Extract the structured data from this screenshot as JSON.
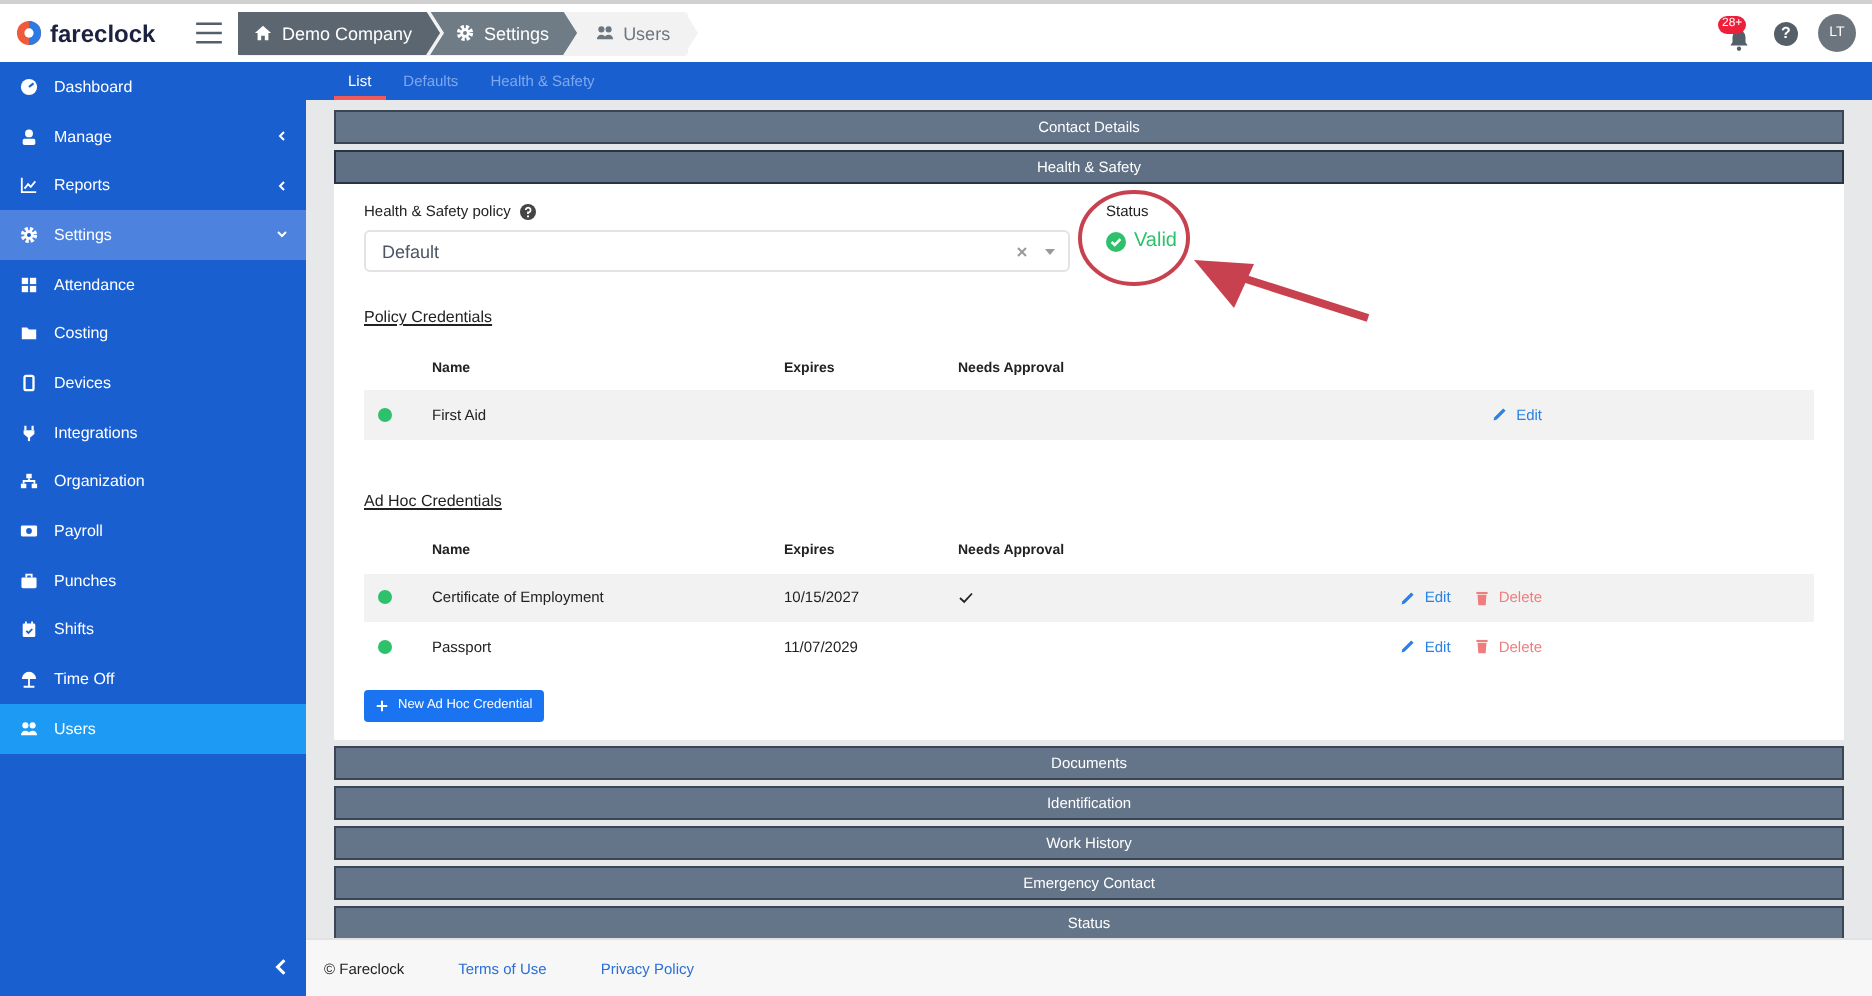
{
  "header": {
    "logo": "fareclock",
    "breadcrumb": [
      {
        "label": "Demo Company"
      },
      {
        "label": "Settings"
      },
      {
        "label": "Users"
      }
    ],
    "notification_badge": "28+",
    "help": "?",
    "avatar": "LT"
  },
  "sidebar": {
    "items": [
      {
        "label": "Dashboard",
        "selected": false
      },
      {
        "label": "Manage",
        "selected": false,
        "expanded": false
      },
      {
        "label": "Reports",
        "selected": false,
        "expanded": false
      },
      {
        "label": "Settings",
        "selected": false,
        "expanded": true,
        "children": [
          {
            "label": "Attendance",
            "selected": false
          },
          {
            "label": "Costing",
            "selected": false
          },
          {
            "label": "Devices",
            "selected": false
          },
          {
            "label": "Integrations",
            "selected": false
          },
          {
            "label": "Organization",
            "selected": false
          },
          {
            "label": "Payroll",
            "selected": false
          },
          {
            "label": "Punches",
            "selected": false
          },
          {
            "label": "Shifts",
            "selected": false
          },
          {
            "label": "Time Off",
            "selected": false
          },
          {
            "label": "Users",
            "selected": true
          }
        ]
      }
    ]
  },
  "tabs": [
    {
      "label": "List",
      "selected": true
    },
    {
      "label": "Defaults",
      "selected": false
    },
    {
      "label": "Health & Safety",
      "selected": false
    }
  ],
  "sections": [
    {
      "title": "Contact Details",
      "expanded": false
    },
    {
      "title": "Health & Safety",
      "expanded": true
    },
    {
      "title": "Documents",
      "expanded": false
    },
    {
      "title": "Identification",
      "expanded": false
    },
    {
      "title": "Work History",
      "expanded": false
    },
    {
      "title": "Emergency Contact",
      "expanded": false
    },
    {
      "title": "Status",
      "expanded": false
    }
  ],
  "health_safety": {
    "policy_label": "Health & Safety policy",
    "policy_value": "Default",
    "status_label": "Status",
    "status": "Valid",
    "credential_groups": [
      {
        "title": "Policy Credentials",
        "columns": [
          "Name",
          "Expires",
          "Needs Approval"
        ],
        "rows": [
          {
            "name": "First Aid",
            "actions": [
              {
                "kind": "edit",
                "label": "Edit"
              }
            ]
          }
        ]
      },
      {
        "title": "Ad Hoc Credentials",
        "columns": [
          "Name",
          "Expires",
          "Needs Approval"
        ],
        "rows": [
          {
            "name": "Certificate of Employment",
            "expires": "10/15/2027",
            "needs_approval": true,
            "actions": [
              {
                "kind": "edit",
                "label": "Edit"
              },
              {
                "kind": "delete",
                "label": "Delete"
              }
            ]
          },
          {
            "name": "Passport",
            "expires": "11/07/2029",
            "actions": [
              {
                "kind": "edit",
                "label": "Edit"
              },
              {
                "kind": "delete",
                "label": "Delete"
              }
            ]
          }
        ]
      }
    ],
    "new_button": "New Ad Hoc Credential"
  },
  "footer": {
    "copyright": "© Fareclock",
    "links": [
      "Terms of Use",
      "Privacy Policy"
    ]
  }
}
